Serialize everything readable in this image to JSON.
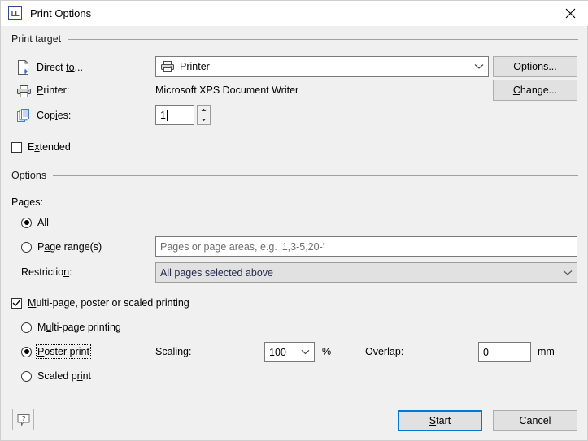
{
  "window": {
    "title": "Print Options",
    "app_icon_text": "LL",
    "close_icon": "close-icon"
  },
  "sections": {
    "print_target": {
      "title": "Print target"
    },
    "options": {
      "title": "Options"
    }
  },
  "print_target": {
    "direct_to": {
      "label": "Direct to...",
      "mnemonic": "to",
      "icon": "document-export-icon",
      "value": "Printer",
      "value_icon": "printer-icon"
    },
    "printer": {
      "label": "Printer:",
      "mnemonic": "P",
      "icon": "printer-icon",
      "value": "Microsoft XPS Document Writer"
    },
    "copies": {
      "label": "Copies:",
      "mnemonic": "i",
      "icon": "copies-stack-icon",
      "value": "1"
    },
    "buttons": {
      "options": "Options...",
      "change": "Change..."
    }
  },
  "extended": {
    "label": "Extended",
    "mnemonic": "x",
    "checked": false
  },
  "options": {
    "pages_label": "Pages:",
    "radios": [
      {
        "label": "All",
        "mnemonic": "l",
        "selected": true
      },
      {
        "label": "Page range(s)",
        "mnemonic": "a",
        "selected": false
      }
    ],
    "page_range_placeholder": "Pages or page areas, e.g. '1,3-5,20-'",
    "page_range_value": "",
    "restriction": {
      "label": "Restriction:",
      "mnemonic": "n",
      "value": "All pages selected above"
    }
  },
  "multipage": {
    "checkbox_label": "Multi-page, poster or scaled printing",
    "checkbox_mnemonic": "M",
    "checked": true,
    "radios": [
      {
        "label": "Multi-page printing",
        "mnemonic": "u",
        "selected": false,
        "focused": false
      },
      {
        "label": "Poster print",
        "mnemonic": "P",
        "selected": true,
        "focused": true
      },
      {
        "label": "Scaled print",
        "mnemonic": "ri",
        "selected": false,
        "focused": false
      }
    ],
    "scaling": {
      "label": "Scaling:",
      "value": "100",
      "unit": "%"
    },
    "overlap": {
      "label": "Overlap:",
      "value": "0",
      "unit": "mm"
    }
  },
  "footer": {
    "help_icon": "help-question-icon",
    "start": "Start",
    "start_mnemonic": "S",
    "cancel": "Cancel"
  },
  "colors": {
    "background": "#f0f0f0",
    "titlebar": "#ffffff",
    "accent": "#0078d7",
    "border": "#7a7a7a",
    "disabled_field": "#e1e1e1",
    "placeholder_text": "#6d6d6d"
  }
}
